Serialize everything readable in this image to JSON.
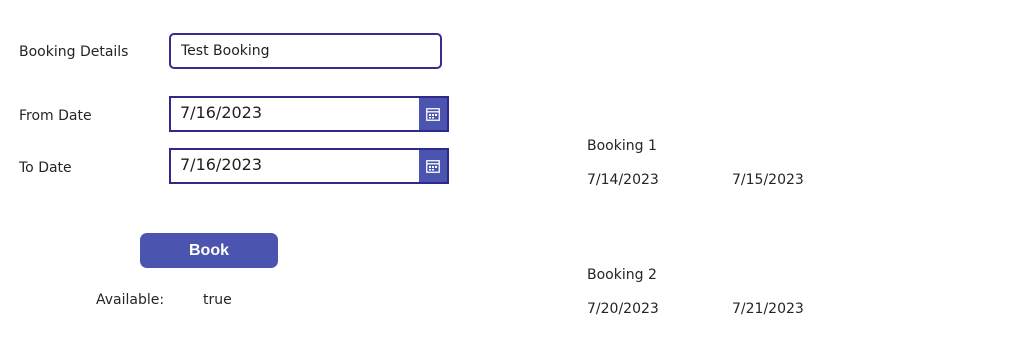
{
  "form": {
    "booking_details_label": "Booking Details",
    "booking_details_value": "Test Booking",
    "from_date_label": "From Date",
    "from_date_value": "7/16/2023",
    "to_date_label": "To Date",
    "to_date_value": "7/16/2023",
    "book_button_label": "Book",
    "available_label": "Available:",
    "available_value": "true"
  },
  "bookings": [
    {
      "title": "Booking 1",
      "start": "7/14/2023",
      "end": "7/15/2023"
    },
    {
      "title": "Booking 2",
      "start": "7/20/2023",
      "end": "7/21/2023"
    }
  ],
  "colors": {
    "accent": "#4b55b0",
    "field_border": "#2f2a8a"
  },
  "icons": {
    "date_picker": "calendar-icon"
  }
}
